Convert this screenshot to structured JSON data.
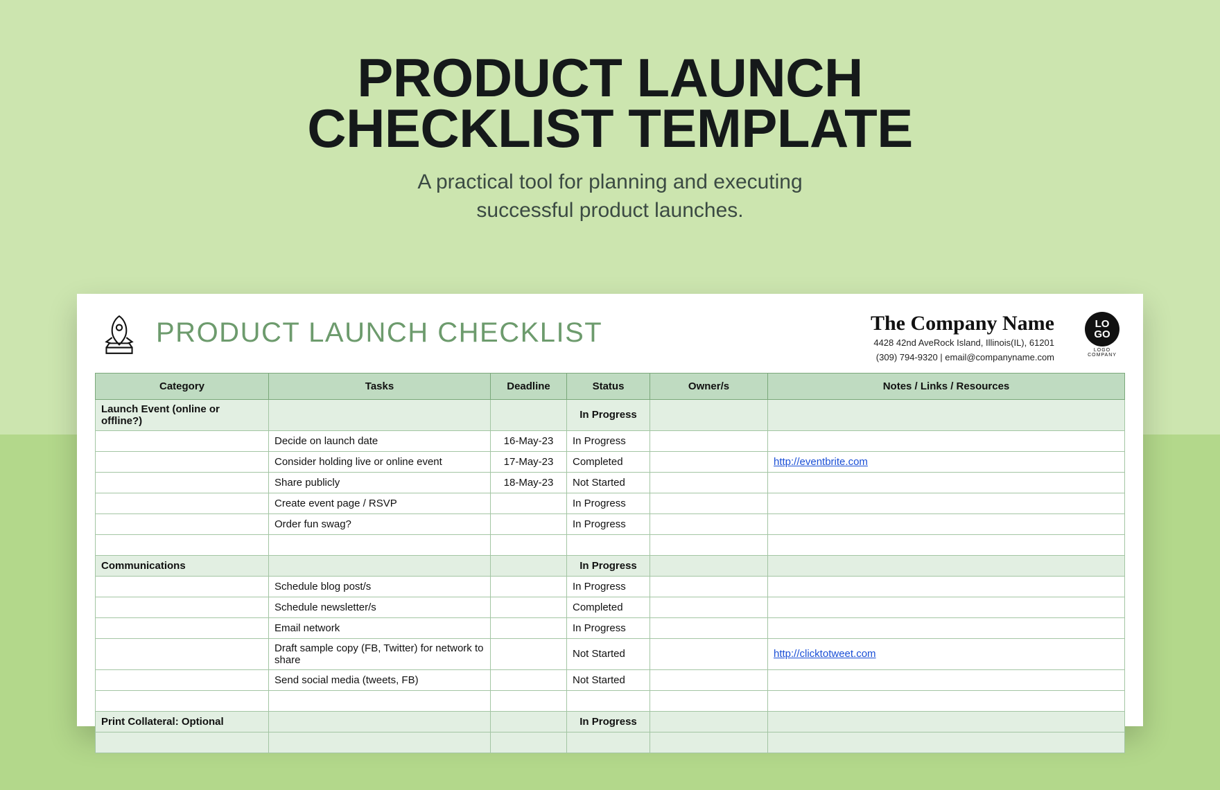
{
  "hero": {
    "title_line1": "PRODUCT LAUNCH",
    "title_line2": "CHECKLIST TEMPLATE",
    "subtitle_line1": "A practical tool for planning and executing",
    "subtitle_line2": "successful product launches."
  },
  "sheet": {
    "title": "PRODUCT LAUNCH CHECKLIST",
    "company": {
      "name": "The Company Name",
      "address": "4428 42nd AveRock Island, Illinois(IL), 61201",
      "contact": "(309) 794-9320 | email@companyname.com"
    },
    "logo": {
      "line1": "LO",
      "line2": "GO",
      "sub": "LOGO COMPANY"
    }
  },
  "table": {
    "headers": {
      "category": "Category",
      "tasks": "Tasks",
      "deadline": "Deadline",
      "status": "Status",
      "owner": "Owner/s",
      "notes": "Notes / Links / Resources"
    },
    "sections": [
      {
        "name": "Launch Event (online or offline?)",
        "status": "In Progress",
        "rows": [
          {
            "task": "Decide on launch date",
            "deadline": "16-May-23",
            "status": "In Progress",
            "owner": "",
            "notes": ""
          },
          {
            "task": "Consider holding live or online event",
            "deadline": "17-May-23",
            "status": "Completed",
            "owner": "",
            "notes": "http://eventbrite.com",
            "link": true
          },
          {
            "task": "Share publicly",
            "deadline": "18-May-23",
            "status": "Not Started",
            "owner": "",
            "notes": ""
          },
          {
            "task": "Create event page / RSVP",
            "deadline": "",
            "status": "In Progress",
            "owner": "",
            "notes": ""
          },
          {
            "task": "Order fun swag?",
            "deadline": "",
            "status": "In Progress",
            "owner": "",
            "notes": ""
          },
          {
            "task": "",
            "deadline": "",
            "status": "",
            "owner": "",
            "notes": ""
          }
        ]
      },
      {
        "name": "Communications",
        "status": "In Progress",
        "rows": [
          {
            "task": "Schedule blog post/s",
            "deadline": "",
            "status": "In Progress",
            "owner": "",
            "notes": ""
          },
          {
            "task": "Schedule newsletter/s",
            "deadline": "",
            "status": "Completed",
            "owner": "",
            "notes": ""
          },
          {
            "task": "Email network",
            "deadline": "",
            "status": "In Progress",
            "owner": "",
            "notes": ""
          },
          {
            "task": "Draft sample copy (FB, Twitter) for network to share",
            "deadline": "",
            "status": "Not Started",
            "owner": "",
            "notes": "http://clicktotweet.com",
            "link": true
          },
          {
            "task": "Send social media (tweets, FB)",
            "deadline": "",
            "status": "Not Started",
            "owner": "",
            "notes": ""
          },
          {
            "task": "",
            "deadline": "",
            "status": "",
            "owner": "",
            "notes": ""
          }
        ]
      },
      {
        "name": "Print Collateral: Optional",
        "status": "In Progress",
        "rows": [
          {
            "task": "",
            "deadline": "",
            "status": "",
            "owner": "",
            "notes": "",
            "section_colored": true
          }
        ]
      }
    ]
  }
}
